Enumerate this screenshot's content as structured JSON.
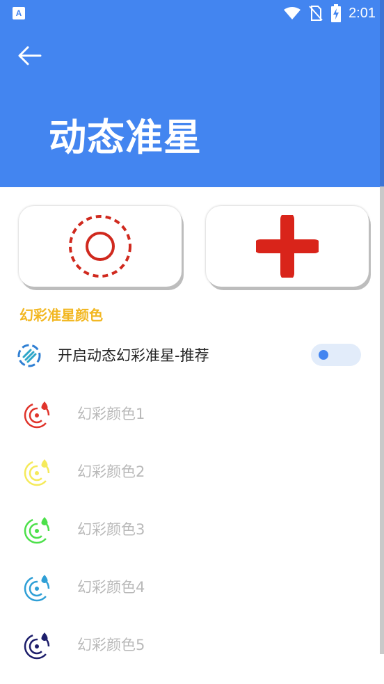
{
  "status_bar": {
    "time": "2:01",
    "app_badge": "A"
  },
  "header": {
    "title": "动态准星"
  },
  "modes": [
    {
      "name": "dashed-circle-crosshair",
      "color": "#D0291E"
    },
    {
      "name": "plus-crosshair",
      "color": "#D9241A"
    }
  ],
  "section": {
    "title": "幻彩准星颜色"
  },
  "toggle": {
    "label": "开启动态幻彩准星-推荐",
    "state": "off"
  },
  "color_options": [
    {
      "label": "幻彩颜色1",
      "color": "#E0342B"
    },
    {
      "label": "幻彩颜色2",
      "color": "#F5EA5A"
    },
    {
      "label": "幻彩颜色3",
      "color": "#4CE04A"
    },
    {
      "label": "幻彩颜色4",
      "color": "#2F9FD6"
    },
    {
      "label": "幻彩颜色5",
      "color": "#1D1E6B"
    }
  ],
  "colors": {
    "header_bg": "#4385F0",
    "section_title": "#F2B721",
    "accent": "#4385F0"
  }
}
